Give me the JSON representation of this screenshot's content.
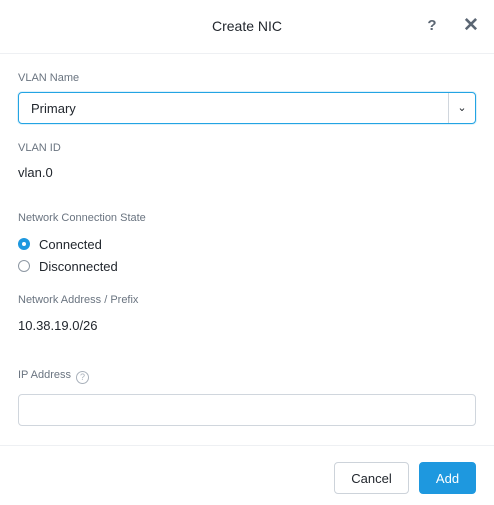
{
  "dialog": {
    "title": "Create NIC",
    "help_icon": "?",
    "close_icon": "✕"
  },
  "vlan_name": {
    "label": "VLAN Name",
    "selected": "Primary",
    "chevron": "⌄"
  },
  "vlan_id": {
    "label": "VLAN ID",
    "value": "vlan.0"
  },
  "connection_state": {
    "label": "Network Connection State",
    "options": [
      {
        "label": "Connected",
        "checked": true
      },
      {
        "label": "Disconnected",
        "checked": false
      }
    ]
  },
  "network_address": {
    "label": "Network Address / Prefix",
    "value": "10.38.19.0/26"
  },
  "ip_address": {
    "label": "IP Address",
    "help_icon": "?",
    "value": "",
    "placeholder": ""
  },
  "footer": {
    "cancel_label": "Cancel",
    "add_label": "Add"
  },
  "colors": {
    "accent": "#1e98df",
    "focus_border": "#23a4e3"
  }
}
